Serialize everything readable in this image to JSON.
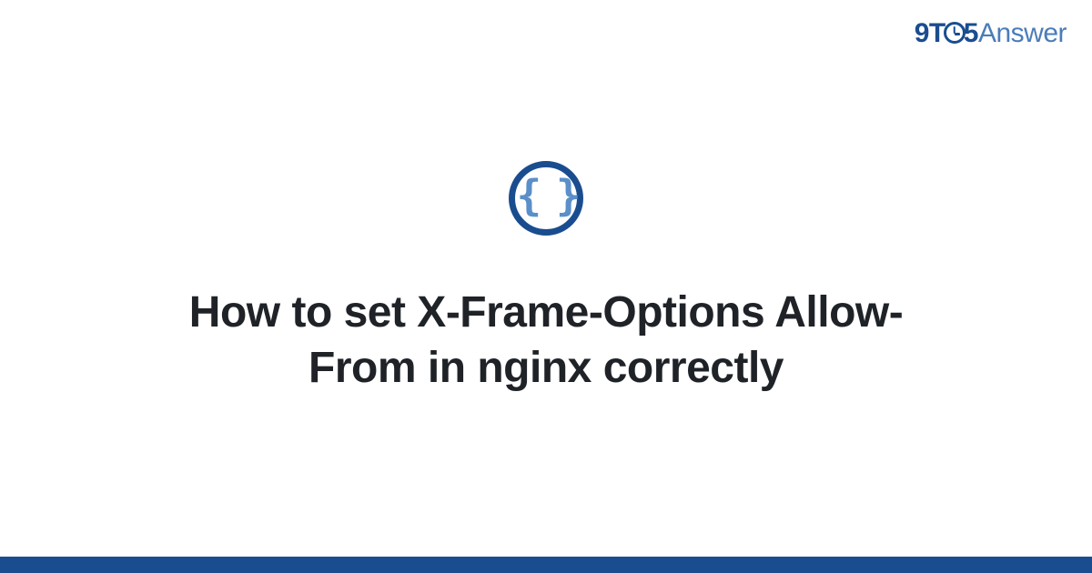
{
  "brand": {
    "part1": "9T",
    "part2": "5",
    "part3": "Answer"
  },
  "icon": {
    "glyph": "{ }",
    "semantic": "code-braces-icon"
  },
  "title": "How to set X-Frame-Options Allow-From in nginx correctly",
  "colors": {
    "brand_dark": "#1a4d8f",
    "brand_light": "#4a7db8",
    "icon_braces": "#5a8fc9",
    "text": "#1f2328"
  }
}
